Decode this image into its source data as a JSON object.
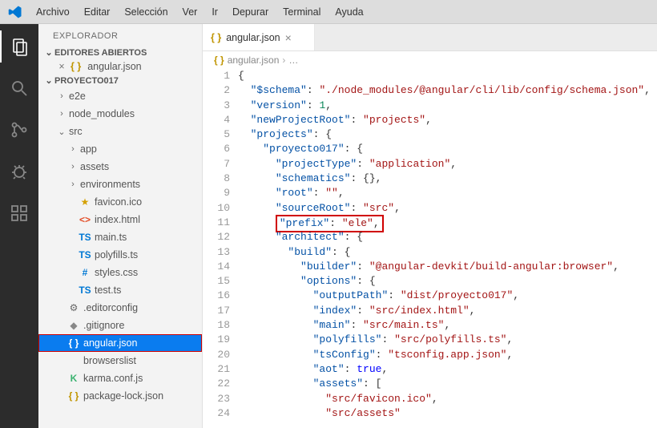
{
  "menu": [
    "Archivo",
    "Editar",
    "Selección",
    "Ver",
    "Ir",
    "Depurar",
    "Terminal",
    "Ayuda"
  ],
  "activity": [
    {
      "name": "explorer-icon",
      "active": true
    },
    {
      "name": "search-icon"
    },
    {
      "name": "scm-icon"
    },
    {
      "name": "debug-icon"
    },
    {
      "name": "extensions-icon"
    }
  ],
  "sidebar": {
    "title": "EXPLORADOR",
    "openEditorsHeader": "EDITORES ABIERTOS",
    "openEditors": [
      {
        "icon": "json",
        "label": "angular.json"
      }
    ],
    "projectHeader": "PROYECTO017",
    "tree": [
      {
        "type": "folder",
        "state": "closed",
        "label": "e2e",
        "depth": 1,
        "name": "folder-e2e"
      },
      {
        "type": "folder",
        "state": "closed",
        "label": "node_modules",
        "depth": 1,
        "name": "folder-node-modules"
      },
      {
        "type": "folder",
        "state": "open",
        "label": "src",
        "depth": 1,
        "name": "folder-src"
      },
      {
        "type": "folder",
        "state": "closed",
        "label": "app",
        "depth": 2,
        "name": "folder-app"
      },
      {
        "type": "folder",
        "state": "closed",
        "label": "assets",
        "depth": 2,
        "name": "folder-assets"
      },
      {
        "type": "folder",
        "state": "closed",
        "label": "environments",
        "depth": 2,
        "name": "folder-environments"
      },
      {
        "type": "file",
        "icon": "star",
        "label": "favicon.ico",
        "depth": 2,
        "name": "file-favicon"
      },
      {
        "type": "file",
        "icon": "html",
        "label": "index.html",
        "depth": 2,
        "name": "file-index-html"
      },
      {
        "type": "file",
        "icon": "ts",
        "label": "main.ts",
        "depth": 2,
        "name": "file-main-ts"
      },
      {
        "type": "file",
        "icon": "ts",
        "label": "polyfills.ts",
        "depth": 2,
        "name": "file-polyfills-ts"
      },
      {
        "type": "file",
        "icon": "css",
        "label": "styles.css",
        "depth": 2,
        "name": "file-styles-css"
      },
      {
        "type": "file",
        "icon": "ts",
        "label": "test.ts",
        "depth": 2,
        "name": "file-test-ts"
      },
      {
        "type": "file",
        "icon": "gear",
        "label": ".editorconfig",
        "depth": 1,
        "name": "file-editorconfig"
      },
      {
        "type": "file",
        "icon": "git",
        "label": ".gitignore",
        "depth": 1,
        "name": "file-gitignore"
      },
      {
        "type": "file",
        "icon": "json",
        "label": "angular.json",
        "depth": 1,
        "selected": true,
        "outlined": true,
        "name": "file-angular-json"
      },
      {
        "type": "file",
        "icon": "blank",
        "label": "browserslist",
        "depth": 1,
        "name": "file-browserslist"
      },
      {
        "type": "file",
        "icon": "k",
        "label": "karma.conf.js",
        "depth": 1,
        "name": "file-karma-conf"
      },
      {
        "type": "file",
        "icon": "json",
        "label": "package-lock.json",
        "depth": 1,
        "name": "file-package-lock"
      }
    ]
  },
  "tab": {
    "icon": "json",
    "label": "angular.json"
  },
  "breadcrumbs": {
    "icon": "json",
    "file": "angular.json",
    "trail": "…"
  },
  "code": {
    "lines": [
      {
        "n": 1,
        "ind": 0,
        "tokens": [
          {
            "t": "punc",
            "v": "{"
          }
        ]
      },
      {
        "n": 2,
        "ind": 1,
        "tokens": [
          {
            "t": "key",
            "v": "\"$schema\""
          },
          {
            "t": "punc",
            "v": ": "
          },
          {
            "t": "str",
            "v": "\"./node_modules/@angular/cli/lib/config/schema.json\""
          },
          {
            "t": "punc",
            "v": ","
          }
        ]
      },
      {
        "n": 3,
        "ind": 1,
        "tokens": [
          {
            "t": "key",
            "v": "\"version\""
          },
          {
            "t": "punc",
            "v": ": "
          },
          {
            "t": "num",
            "v": "1"
          },
          {
            "t": "punc",
            "v": ","
          }
        ]
      },
      {
        "n": 4,
        "ind": 1,
        "tokens": [
          {
            "t": "key",
            "v": "\"newProjectRoot\""
          },
          {
            "t": "punc",
            "v": ": "
          },
          {
            "t": "str",
            "v": "\"projects\""
          },
          {
            "t": "punc",
            "v": ","
          }
        ]
      },
      {
        "n": 5,
        "ind": 1,
        "tokens": [
          {
            "t": "key",
            "v": "\"projects\""
          },
          {
            "t": "punc",
            "v": ": {"
          }
        ]
      },
      {
        "n": 6,
        "ind": 2,
        "tokens": [
          {
            "t": "key",
            "v": "\"proyecto017\""
          },
          {
            "t": "punc",
            "v": ": {"
          }
        ]
      },
      {
        "n": 7,
        "ind": 3,
        "tokens": [
          {
            "t": "key",
            "v": "\"projectType\""
          },
          {
            "t": "punc",
            "v": ": "
          },
          {
            "t": "str",
            "v": "\"application\""
          },
          {
            "t": "punc",
            "v": ","
          }
        ]
      },
      {
        "n": 8,
        "ind": 3,
        "tokens": [
          {
            "t": "key",
            "v": "\"schematics\""
          },
          {
            "t": "punc",
            "v": ": {},"
          }
        ]
      },
      {
        "n": 9,
        "ind": 3,
        "tokens": [
          {
            "t": "key",
            "v": "\"root\""
          },
          {
            "t": "punc",
            "v": ": "
          },
          {
            "t": "str",
            "v": "\"\""
          },
          {
            "t": "punc",
            "v": ","
          }
        ]
      },
      {
        "n": 10,
        "ind": 3,
        "tokens": [
          {
            "t": "key",
            "v": "\"sourceRoot\""
          },
          {
            "t": "punc",
            "v": ": "
          },
          {
            "t": "str",
            "v": "\"src\""
          },
          {
            "t": "punc",
            "v": ","
          }
        ]
      },
      {
        "n": 11,
        "ind": 3,
        "highlight": true,
        "tokens": [
          {
            "t": "key",
            "v": "\"prefix\""
          },
          {
            "t": "punc",
            "v": ": "
          },
          {
            "t": "str",
            "v": "\"ele\""
          },
          {
            "t": "punc",
            "v": ","
          }
        ]
      },
      {
        "n": 12,
        "ind": 3,
        "tokens": [
          {
            "t": "key",
            "v": "\"architect\""
          },
          {
            "t": "punc",
            "v": ": {"
          }
        ]
      },
      {
        "n": 13,
        "ind": 4,
        "tokens": [
          {
            "t": "key",
            "v": "\"build\""
          },
          {
            "t": "punc",
            "v": ": {"
          }
        ]
      },
      {
        "n": 14,
        "ind": 5,
        "tokens": [
          {
            "t": "key",
            "v": "\"builder\""
          },
          {
            "t": "punc",
            "v": ": "
          },
          {
            "t": "str",
            "v": "\"@angular-devkit/build-angular:browser\""
          },
          {
            "t": "punc",
            "v": ","
          }
        ]
      },
      {
        "n": 15,
        "ind": 5,
        "tokens": [
          {
            "t": "key",
            "v": "\"options\""
          },
          {
            "t": "punc",
            "v": ": {"
          }
        ]
      },
      {
        "n": 16,
        "ind": 6,
        "tokens": [
          {
            "t": "key",
            "v": "\"outputPath\""
          },
          {
            "t": "punc",
            "v": ": "
          },
          {
            "t": "str",
            "v": "\"dist/proyecto017\""
          },
          {
            "t": "punc",
            "v": ","
          }
        ]
      },
      {
        "n": 17,
        "ind": 6,
        "tokens": [
          {
            "t": "key",
            "v": "\"index\""
          },
          {
            "t": "punc",
            "v": ": "
          },
          {
            "t": "str",
            "v": "\"src/index.html\""
          },
          {
            "t": "punc",
            "v": ","
          }
        ]
      },
      {
        "n": 18,
        "ind": 6,
        "tokens": [
          {
            "t": "key",
            "v": "\"main\""
          },
          {
            "t": "punc",
            "v": ": "
          },
          {
            "t": "str",
            "v": "\"src/main.ts\""
          },
          {
            "t": "punc",
            "v": ","
          }
        ]
      },
      {
        "n": 19,
        "ind": 6,
        "tokens": [
          {
            "t": "key",
            "v": "\"polyfills\""
          },
          {
            "t": "punc",
            "v": ": "
          },
          {
            "t": "str",
            "v": "\"src/polyfills.ts\""
          },
          {
            "t": "punc",
            "v": ","
          }
        ]
      },
      {
        "n": 20,
        "ind": 6,
        "tokens": [
          {
            "t": "key",
            "v": "\"tsConfig\""
          },
          {
            "t": "punc",
            "v": ": "
          },
          {
            "t": "str",
            "v": "\"tsconfig.app.json\""
          },
          {
            "t": "punc",
            "v": ","
          }
        ]
      },
      {
        "n": 21,
        "ind": 6,
        "tokens": [
          {
            "t": "key",
            "v": "\"aot\""
          },
          {
            "t": "punc",
            "v": ": "
          },
          {
            "t": "bool",
            "v": "true"
          },
          {
            "t": "punc",
            "v": ","
          }
        ]
      },
      {
        "n": 22,
        "ind": 6,
        "tokens": [
          {
            "t": "key",
            "v": "\"assets\""
          },
          {
            "t": "punc",
            "v": ": ["
          }
        ]
      },
      {
        "n": 23,
        "ind": 7,
        "tokens": [
          {
            "t": "str",
            "v": "\"src/favicon.ico\""
          },
          {
            "t": "punc",
            "v": ","
          }
        ]
      },
      {
        "n": 24,
        "ind": 7,
        "tokens": [
          {
            "t": "str",
            "v": "\"src/assets\""
          }
        ]
      }
    ]
  }
}
